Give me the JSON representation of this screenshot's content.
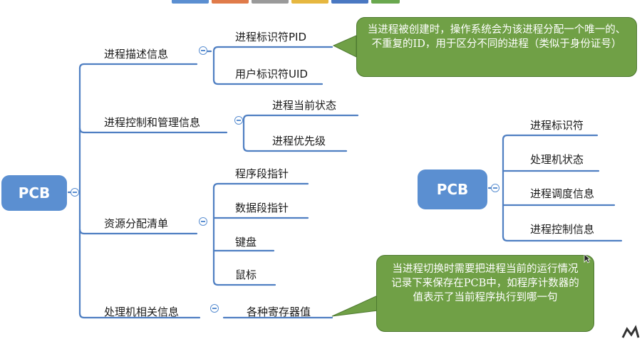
{
  "tab_colors": [
    "#5b8fd1",
    "#e07b4a",
    "#9a9a9a",
    "#e6b740",
    "#4a78c2",
    "#6aa84f"
  ],
  "left_tree": {
    "root": "PCB",
    "branches": [
      {
        "label": "进程描述信息",
        "children": [
          "进程标识符PID",
          "用户标识符UID"
        ]
      },
      {
        "label": "进程控制和管理信息",
        "children": [
          "进程当前状态",
          "进程优先级"
        ]
      },
      {
        "label": "资源分配清单",
        "children": [
          "程序段指针",
          "数据段指针",
          "键盘",
          "鼠标"
        ]
      },
      {
        "label": "处理机相关信息",
        "children": [
          "各种寄存器值"
        ]
      }
    ]
  },
  "right_tree": {
    "root": "PCB",
    "children": [
      "进程标识符",
      "处理机状态",
      "进程调度信息",
      "进程控制信息"
    ]
  },
  "callouts": {
    "top": "当进程被创建时，操作系统会为该进程分配一个唯一的、不重复的ID，用于区分不同的进程（类似于身份证号）",
    "bottom": "当进程切换时需要把进程当前的运行情况记录下来保存在PCB中，如程序计数器的值表示了当前程序执行到哪一句"
  },
  "colors": {
    "node_blue": "#5b8fd1",
    "connector": "#4f7fc2",
    "callout_green": "#70a046",
    "callout_border": "#4e7a30"
  }
}
